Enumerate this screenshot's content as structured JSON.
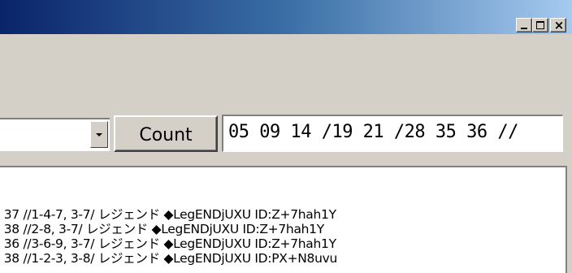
{
  "window": {
    "buttons": {
      "minimize": "minimize-icon",
      "maximize": "maximize-icon",
      "close": "×"
    }
  },
  "controls": {
    "combo_value": "",
    "count_label": "Count",
    "numbers_value": "05 09 14 /19 21 /28 35 36 //"
  },
  "log_lines": [
    " : 37 //1-4-7, 3-7/  レジェンド ◆LegENDjUXU ID:Z+7hah1Y",
    " : 38 //2-8, 3-7/  レジェンド ◆LegENDjUXU ID:Z+7hah1Y",
    " : 36 //3-6-9, 3-7/  レジェンド ◆LegENDjUXU ID:Z+7hah1Y",
    " : 38 //1-2-3, 3-8/  レジェンド ◆LegENDjUXU ID:PX+N8uvu"
  ],
  "colors": {
    "title_start": "#0a246a",
    "title_end": "#a6caf0",
    "face": "#d4d0c8"
  }
}
